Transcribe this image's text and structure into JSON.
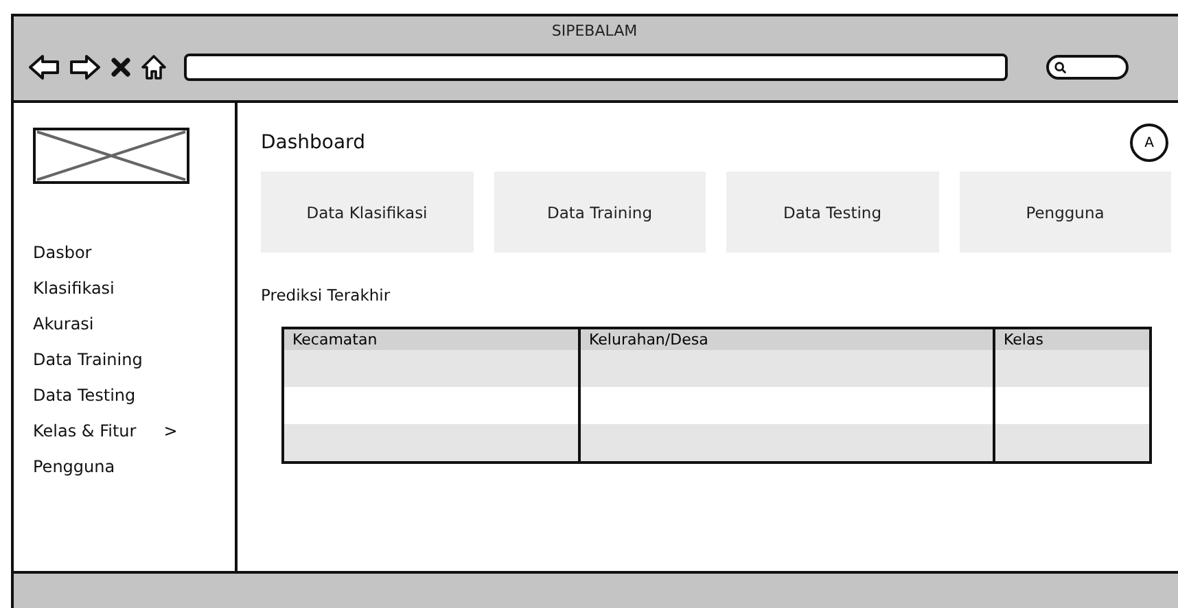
{
  "window": {
    "title": "SIPEBALAM"
  },
  "sidebar": {
    "items": [
      {
        "label": "Dasbor"
      },
      {
        "label": "Klasifikasi"
      },
      {
        "label": "Akurasi"
      },
      {
        "label": "Data Training"
      },
      {
        "label": "Data Testing"
      },
      {
        "label": "Kelas & Fitur",
        "arrow": ">"
      },
      {
        "label": "Pengguna"
      }
    ]
  },
  "header": {
    "title": "Dashboard",
    "avatar": "A"
  },
  "cards": [
    {
      "label": "Data Klasifikasi"
    },
    {
      "label": "Data Training"
    },
    {
      "label": "Data Testing"
    },
    {
      "label": "Pengguna"
    }
  ],
  "table": {
    "title": "Prediksi Terakhir",
    "columns": [
      "Kecamatan",
      "Kelurahan/Desa",
      "Kelas"
    ],
    "rows": [
      {
        "shaded": true
      },
      {
        "shaded": false
      },
      {
        "shaded": true
      }
    ]
  }
}
